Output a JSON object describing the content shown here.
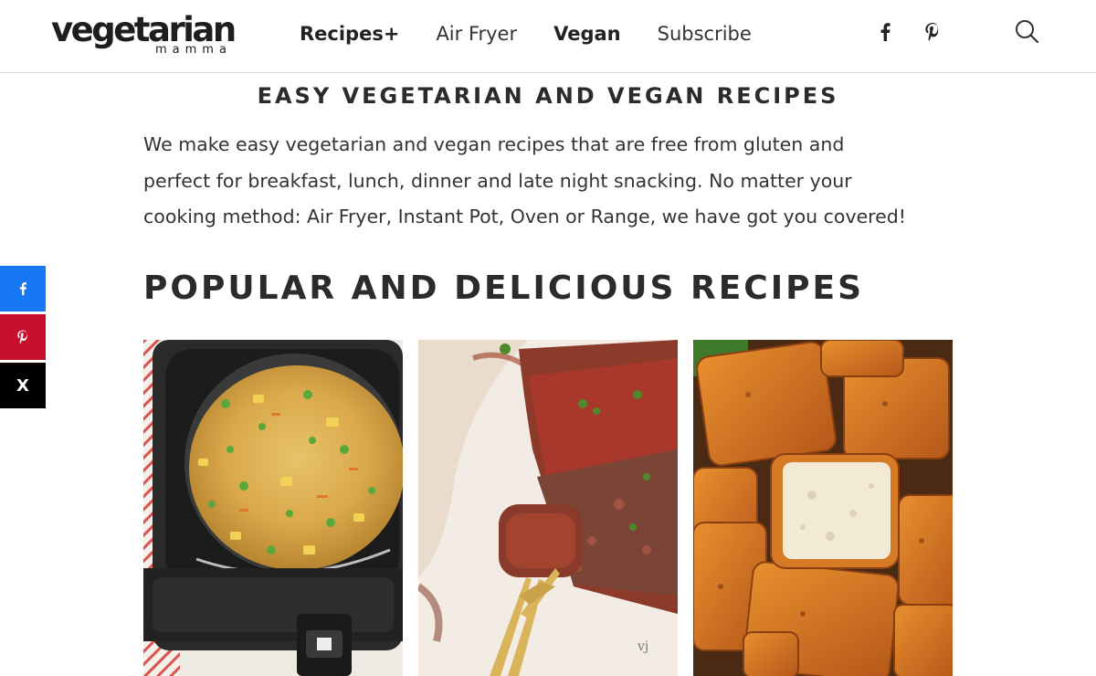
{
  "header": {
    "logo_main": "vegetarian",
    "logo_sub": "mamma",
    "nav": [
      "Recipes+",
      "Air Fryer",
      "Vegan",
      "Subscribe"
    ],
    "social": [
      "f",
      "p"
    ]
  },
  "intro": {
    "title": "EASY VEGETARIAN AND VEGAN RECIPES",
    "lines": [
      "We make easy vegetarian and vegan recipes that are free from gluten and",
      "perfect for breakfast, lunch, dinner and late night snacking. No matter your",
      "cooking method: Air Fryer, Instant Pot, Oven or Range, we have got you covered!"
    ]
  },
  "popular": {
    "title": "POPULAR AND DELICIOUS RECIPES"
  },
  "share": {
    "facebook": "f",
    "pinterest": "p",
    "x": "X",
    "colors": {
      "facebook": "#1877f2",
      "pinterest": "#c8102e",
      "x": "#000000"
    }
  },
  "icons": {
    "search": "search-icon",
    "facebook": "facebook-icon",
    "pinterest": "pinterest-icon",
    "x": "x-icon"
  }
}
